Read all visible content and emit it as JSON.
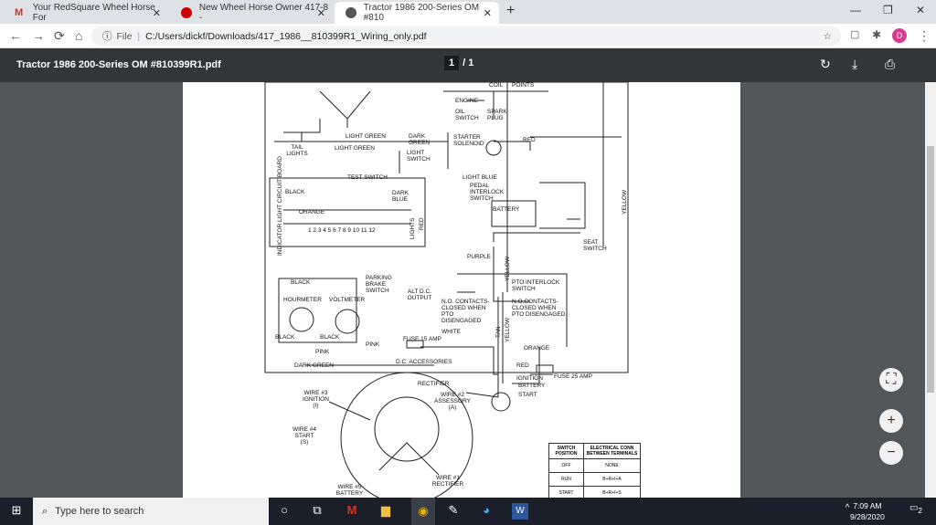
{
  "browser": {
    "tabs": [
      {
        "title": "Your RedSquare Wheel Horse For",
        "icon": "gmail-icon"
      },
      {
        "title": "New Wheel Horse Owner 417-8 -",
        "icon": "redsquare-icon"
      },
      {
        "title": "Tractor 1986 200-Series OM #810",
        "icon": "globe-icon",
        "active": true
      }
    ],
    "new_tab": "+",
    "url_scheme": "File",
    "url": "C:/Users/dickf/Downloads/417_1986__810399R1_Wiring_only.pdf",
    "profile_initial": "D",
    "profile_color": "#d93a8c"
  },
  "pdf": {
    "title": "Tractor 1986 200-Series OM #810399R1.pdf",
    "current_page": "1",
    "page_sep": "/",
    "total_pages": "1"
  },
  "diagram": {
    "labels": [
      "COIL",
      "POINTS",
      "ENGINE",
      "OIL SWITCH",
      "SPARK PLUG",
      "TAIL LIGHTS",
      "LIGHT GREEN",
      "LIGHT GREEN",
      "DARK GREEN",
      "LIGHT SWITCH",
      "STARTER SOLENOID",
      "RED",
      "TEST SWITCH",
      "LIGHT BLUE",
      "PEDAL INTERLOCK SWITCH",
      "BLACK",
      "DARK BLUE",
      "BATTERY",
      "ORANGE",
      "INDICATOR LIGHT CIRCUIT BOARD",
      "1 2 3 4 5 6 7 8 9 10 11 12",
      "LIGHTS",
      "RED",
      "SEAT SWITCH",
      "YELLOW",
      "PURPLE",
      "YELLOW",
      "BLACK",
      "PARKING BRAKE SWITCH",
      "PTO INTERLOCK SWITCH",
      "HOURMETER",
      "VOLTMETER",
      "ALT D.C. OUTPUT",
      "N.O. CONTACTS- CLOSED WHEN PTO DISENGAGED",
      "N.O.CONTACTS- CLOSED WHEN PTO DISENGAGED",
      "WHITE",
      "BLACK",
      "BLACK",
      "PINK",
      "FUSE 15 AMP",
      "ORANGE",
      "PINK",
      "YELLOW",
      "TAN",
      "D.C. ACCESSORIES",
      "DARK GREEN",
      "RED",
      "RECTIFIER",
      "IGNITION",
      "BATTERY",
      "START",
      "FUSE 25 AMP",
      "WIRE #3 IGNITION (I)",
      "WIRE #2 ASSESSORY (A)",
      "WIRE #4 START (S)",
      "WIRE #1 RECTIFIER",
      "WIRE #5 BATTERY"
    ],
    "switch_table": {
      "headers": [
        "SWITCH POSITION",
        "ELECTRICAL CONN BETWEEN TERMINALS"
      ],
      "rows": [
        [
          "OFF",
          "NONE"
        ],
        [
          "RUN",
          "B+R+I+A"
        ],
        [
          "START",
          "B+R+I+S"
        ]
      ]
    }
  },
  "taskbar": {
    "search_placeholder": "Type here to search",
    "time": "7:09 AM",
    "date": "9/28/2020",
    "notifications": "2"
  }
}
